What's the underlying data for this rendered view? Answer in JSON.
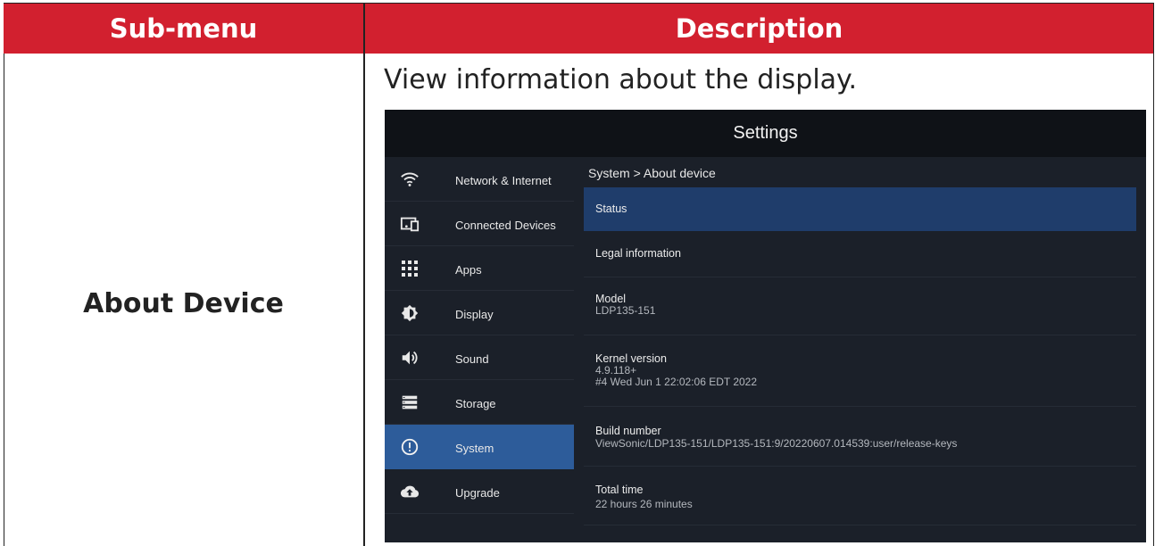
{
  "table": {
    "header_left": "Sub-menu",
    "header_right": "Description",
    "row_label": "About Device",
    "description": "View information about the display."
  },
  "screen": {
    "title": "Settings",
    "breadcrumb": "System > About device",
    "sidebar": [
      {
        "label": "Network & Internet",
        "icon": "wifi-icon",
        "active": false
      },
      {
        "label": "Connected Devices",
        "icon": "connected-devices-icon",
        "active": false
      },
      {
        "label": "Apps",
        "icon": "apps-grid-icon",
        "active": false
      },
      {
        "label": "Display",
        "icon": "brightness-icon",
        "active": false
      },
      {
        "label": "Sound",
        "icon": "speaker-icon",
        "active": false
      },
      {
        "label": "Storage",
        "icon": "storage-icon",
        "active": false
      },
      {
        "label": "System",
        "icon": "info-icon",
        "active": true
      },
      {
        "label": "Upgrade",
        "icon": "cloud-upload-icon",
        "active": false
      }
    ],
    "items": [
      {
        "title": "Status",
        "lines": []
      },
      {
        "title": "Legal information",
        "lines": []
      },
      {
        "title": "Model",
        "lines": [
          "LDP135-151"
        ]
      },
      {
        "title": "Kernel version",
        "lines": [
          "4.9.118+",
          "#4 Wed Jun 1 22:02:06 EDT 2022"
        ]
      },
      {
        "title": "Build number",
        "lines": [
          "ViewSonic/LDP135-151/LDP135-151:9/20220607.014539:user/release-keys"
        ]
      },
      {
        "title": "Total time",
        "lines": [
          "22 hours 26 minutes"
        ]
      }
    ]
  },
  "colors": {
    "header_red": "#d2202f",
    "screen_bg": "#1b2029",
    "active_sidebar": "#2d5c9a",
    "active_item": "#1f3d6b"
  }
}
